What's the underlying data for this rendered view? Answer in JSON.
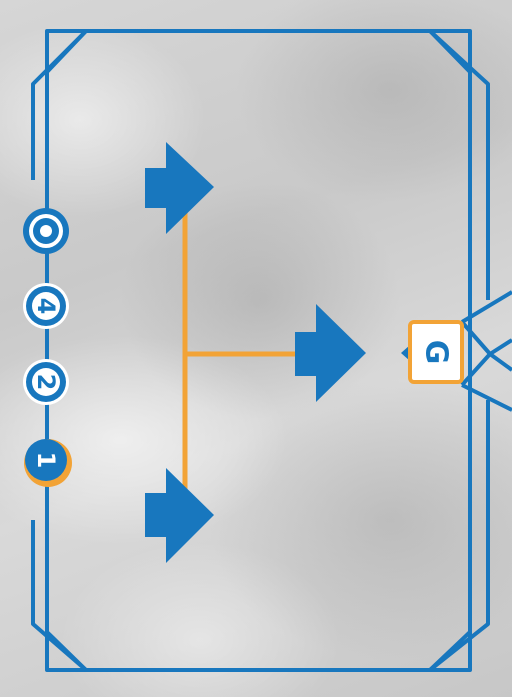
{
  "card": {
    "badges": [
      {
        "kind": "target",
        "label": ""
      },
      {
        "kind": "number",
        "label": "4"
      },
      {
        "kind": "number",
        "label": "2"
      },
      {
        "kind": "number-highlight",
        "label": "1"
      }
    ],
    "goal_label": "G"
  },
  "colors": {
    "frame_blue": "#1877be",
    "arrow_blue": "#1877be",
    "connector_orange": "#f2a336",
    "background": "#cfcfcf",
    "goal_fill": "#ffffff"
  },
  "icons": {
    "target": "target-icon",
    "arrow": "arrow-right-icon"
  }
}
